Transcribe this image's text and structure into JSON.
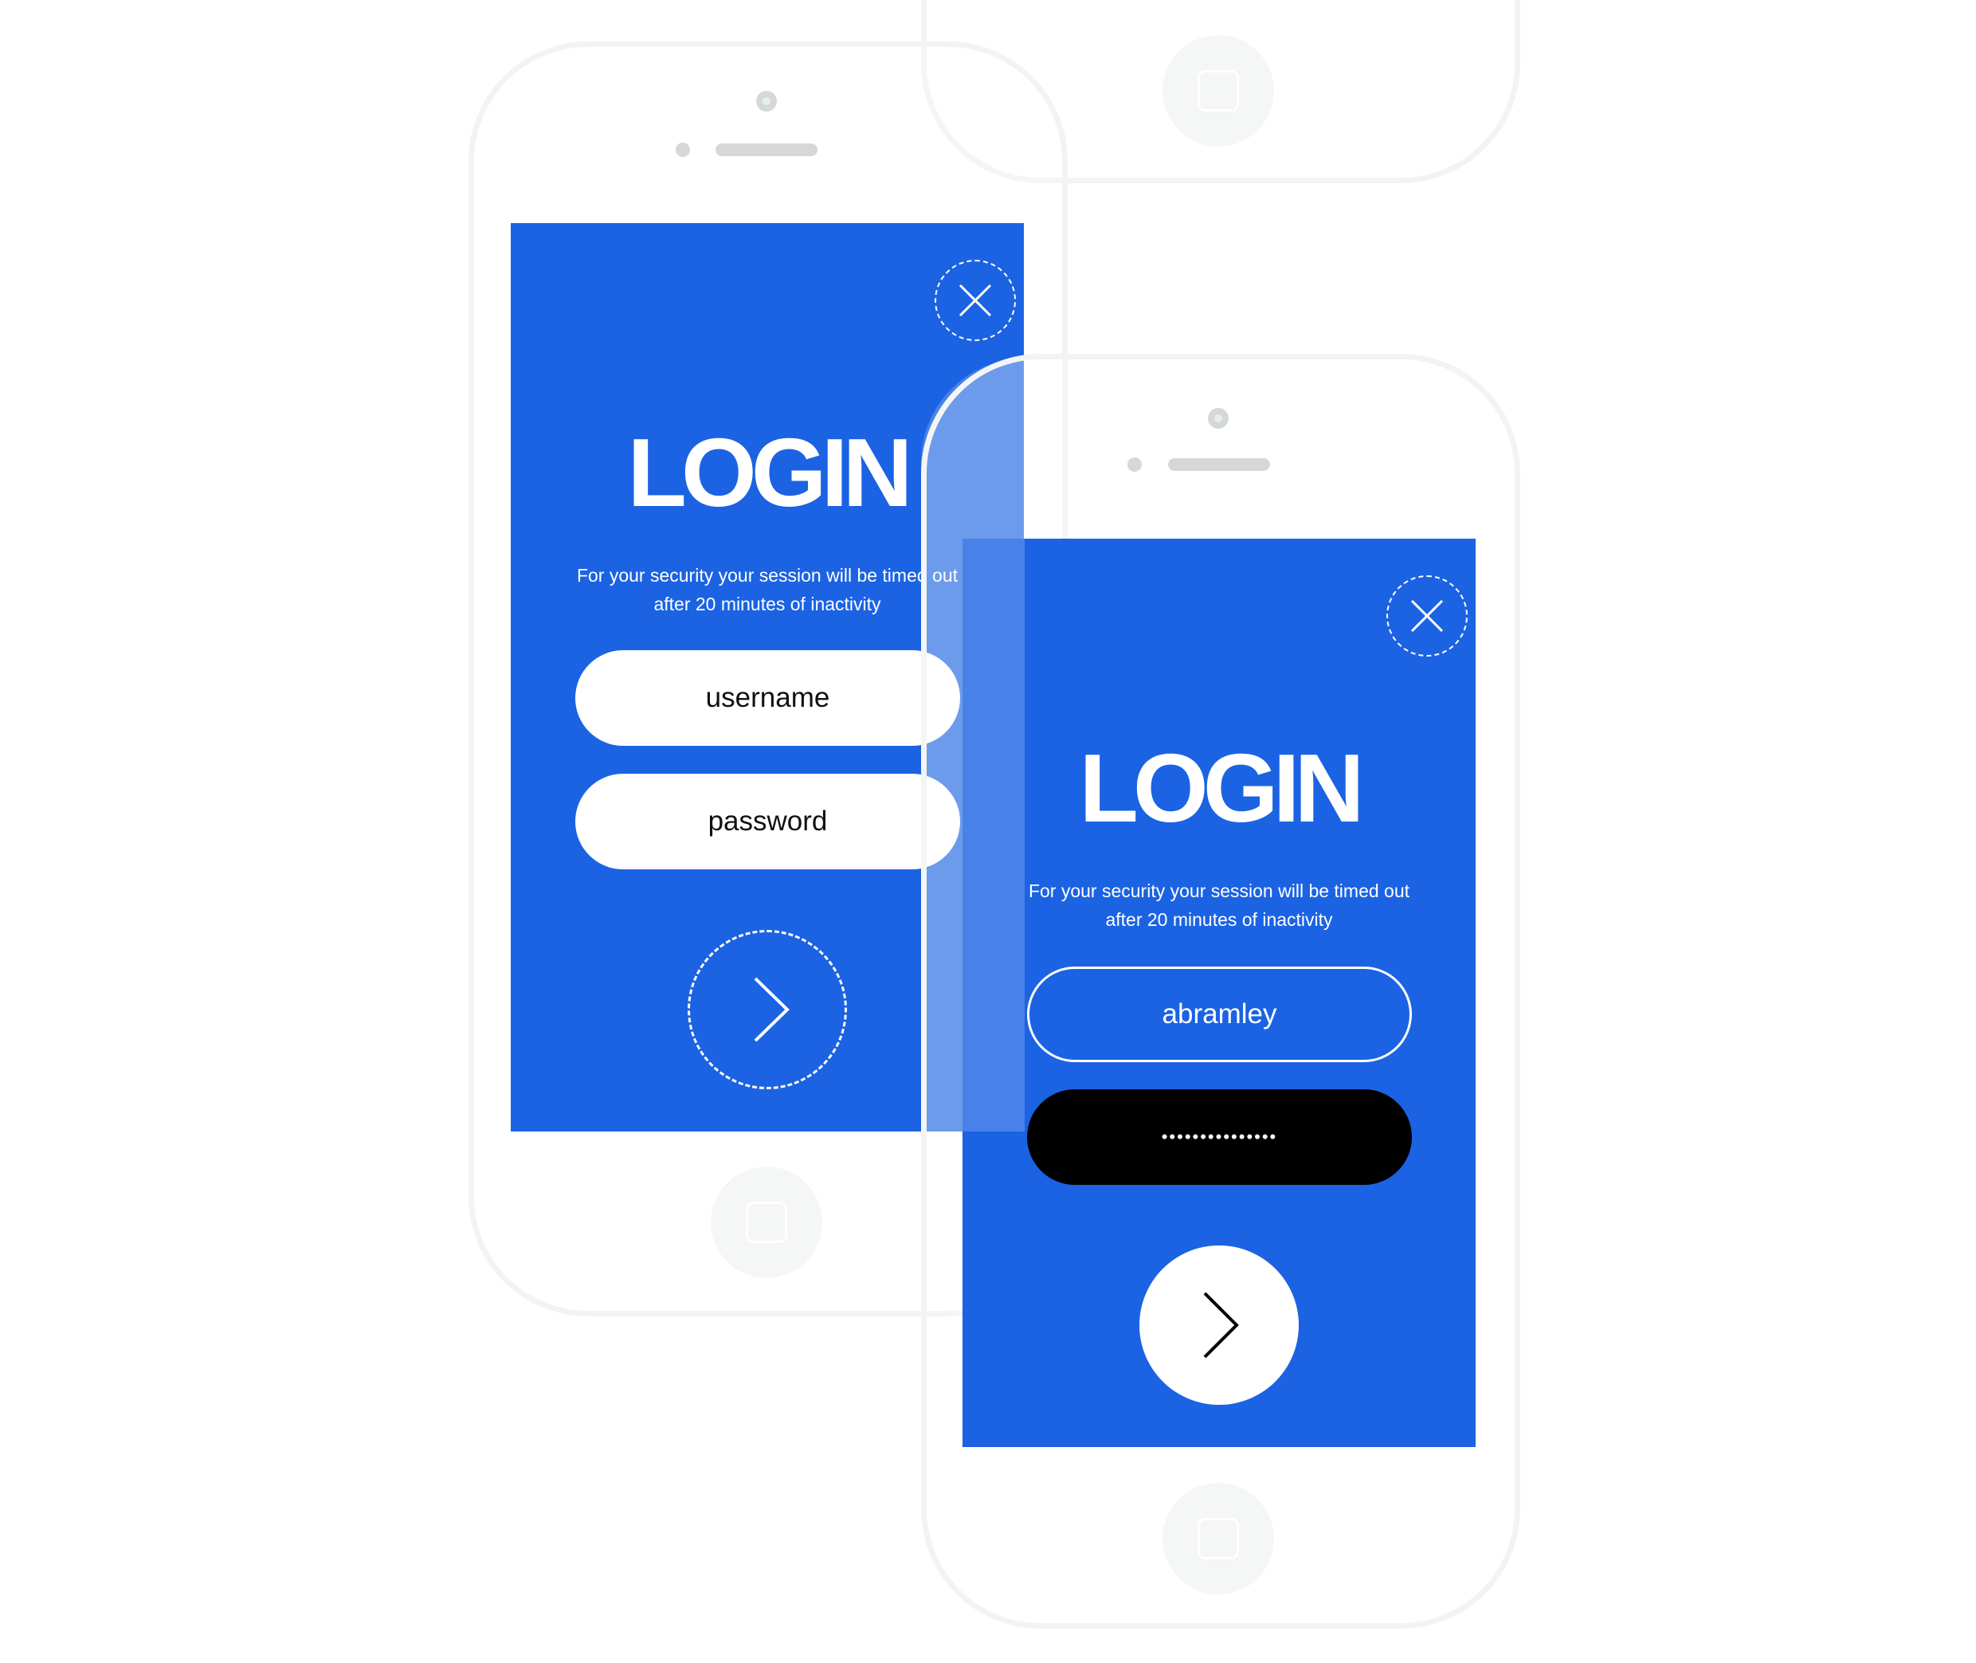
{
  "colors": {
    "accent": "#1b63e3",
    "phone_outline": "#f2f3f3",
    "field_filled": "#000000"
  },
  "left_screen": {
    "title": "LOGIN",
    "subtitle_line1": "For your security your session will be timed out",
    "subtitle_line2": "after 20 minutes of inactivity",
    "username_placeholder": "username",
    "password_placeholder": "password",
    "close_icon": "close-icon",
    "next_icon": "chevron-right-icon"
  },
  "right_screen": {
    "title": "LOGIN",
    "subtitle_line1": "For your security your session will be timed out",
    "subtitle_line2": "after 20 minutes of inactivity",
    "username_value": "abramley",
    "password_value": "•••••••••••••••",
    "close_icon": "close-icon",
    "next_icon": "chevron-right-icon"
  }
}
